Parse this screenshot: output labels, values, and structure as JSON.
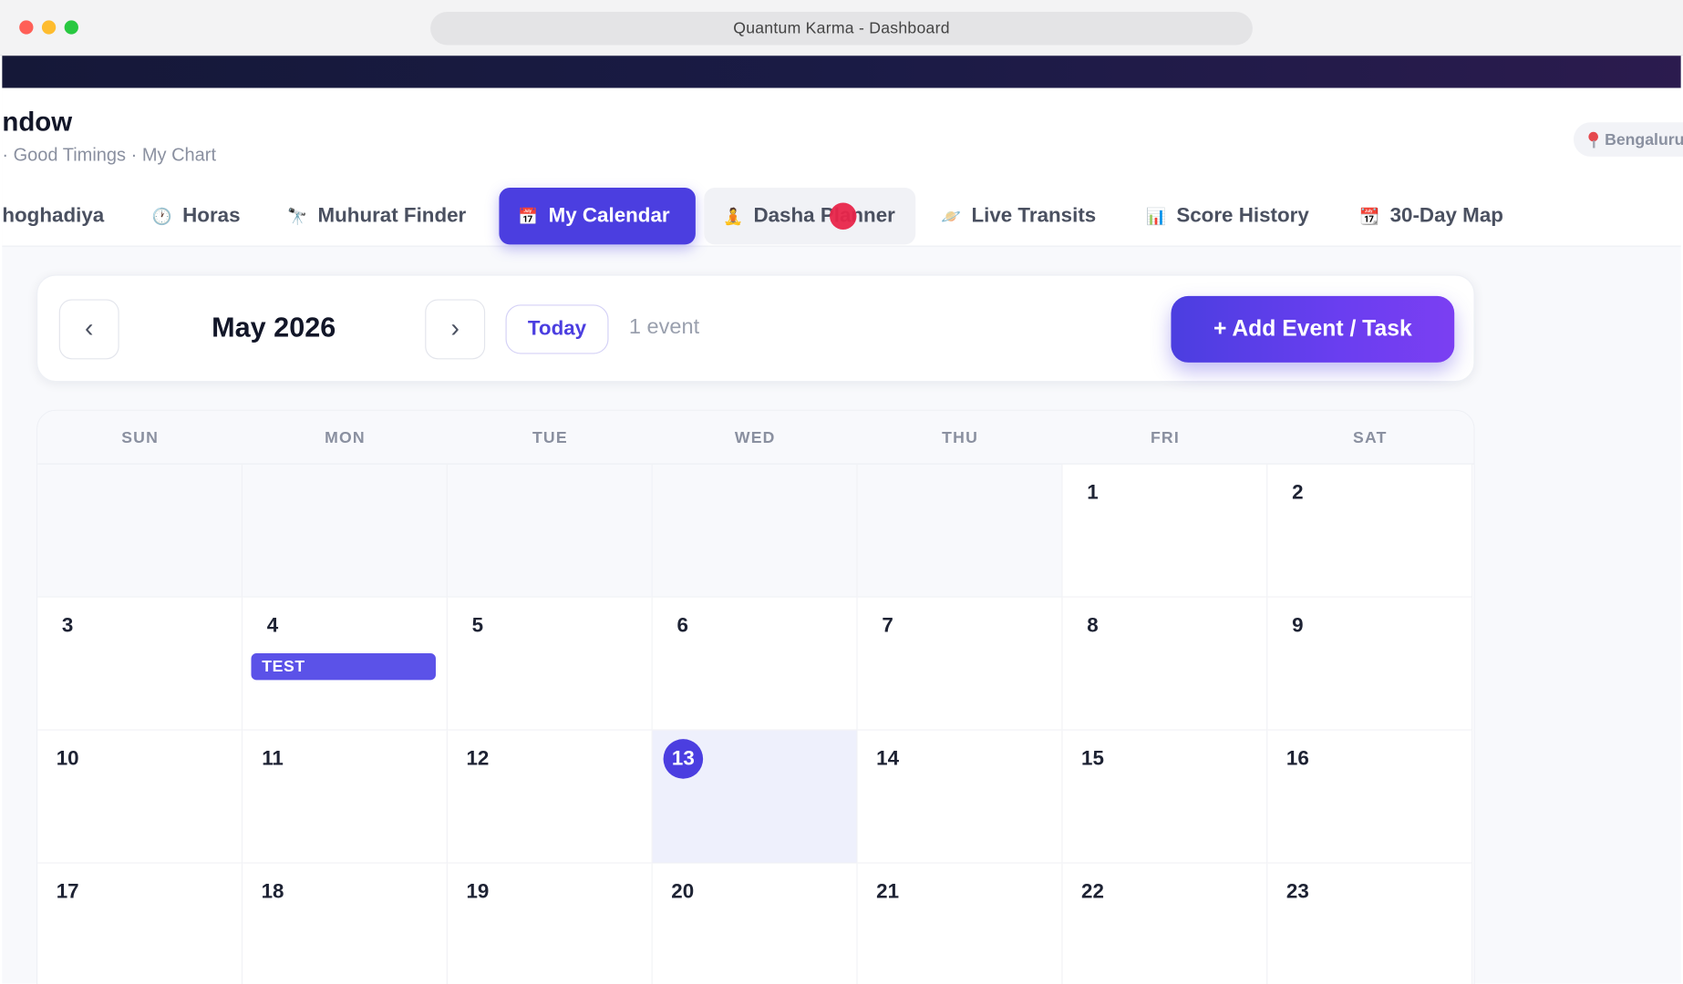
{
  "window": {
    "title": "Quantum Karma - Dashboard"
  },
  "header": {
    "title_partial": "ndow",
    "subtitle_partial": "· Good Timings · My Chart",
    "location": "Bengaluru"
  },
  "tabs": [
    {
      "label": "Choghadiya",
      "visible_text": "hoghadiya",
      "icon": "",
      "active": false
    },
    {
      "label": "Horas",
      "icon": "clock-icon",
      "glyph": "🕐",
      "active": false
    },
    {
      "label": "Muhurat Finder",
      "icon": "telescope-icon",
      "glyph": "🔭",
      "active": false
    },
    {
      "label": "My Calendar",
      "icon": "calendar-icon",
      "glyph": "📅",
      "active": true
    },
    {
      "label": "Dasha Planner",
      "icon": "meditation-icon",
      "glyph": "🧘",
      "active": false,
      "hovered": true
    },
    {
      "label": "Live Transits",
      "icon": "planet-icon",
      "glyph": "🪐",
      "active": false
    },
    {
      "label": "Score History",
      "icon": "bar-chart-icon",
      "glyph": "📊",
      "active": false
    },
    {
      "label": "30-Day Map",
      "icon": "spiral-calendar-icon",
      "glyph": "📆",
      "active": false
    }
  ],
  "toolbar": {
    "prev": "‹",
    "next": "›",
    "month": "May 2026",
    "today": "Today",
    "event_count": "1 event",
    "add": "+ Add Event / Task"
  },
  "calendar": {
    "weekdays": [
      "SUN",
      "MON",
      "TUE",
      "WED",
      "THU",
      "FRI",
      "SAT"
    ],
    "today_day": 13,
    "first_weekday_index": 5,
    "days_shown": 23,
    "events": [
      {
        "day": 4,
        "title": "TEST"
      }
    ]
  }
}
